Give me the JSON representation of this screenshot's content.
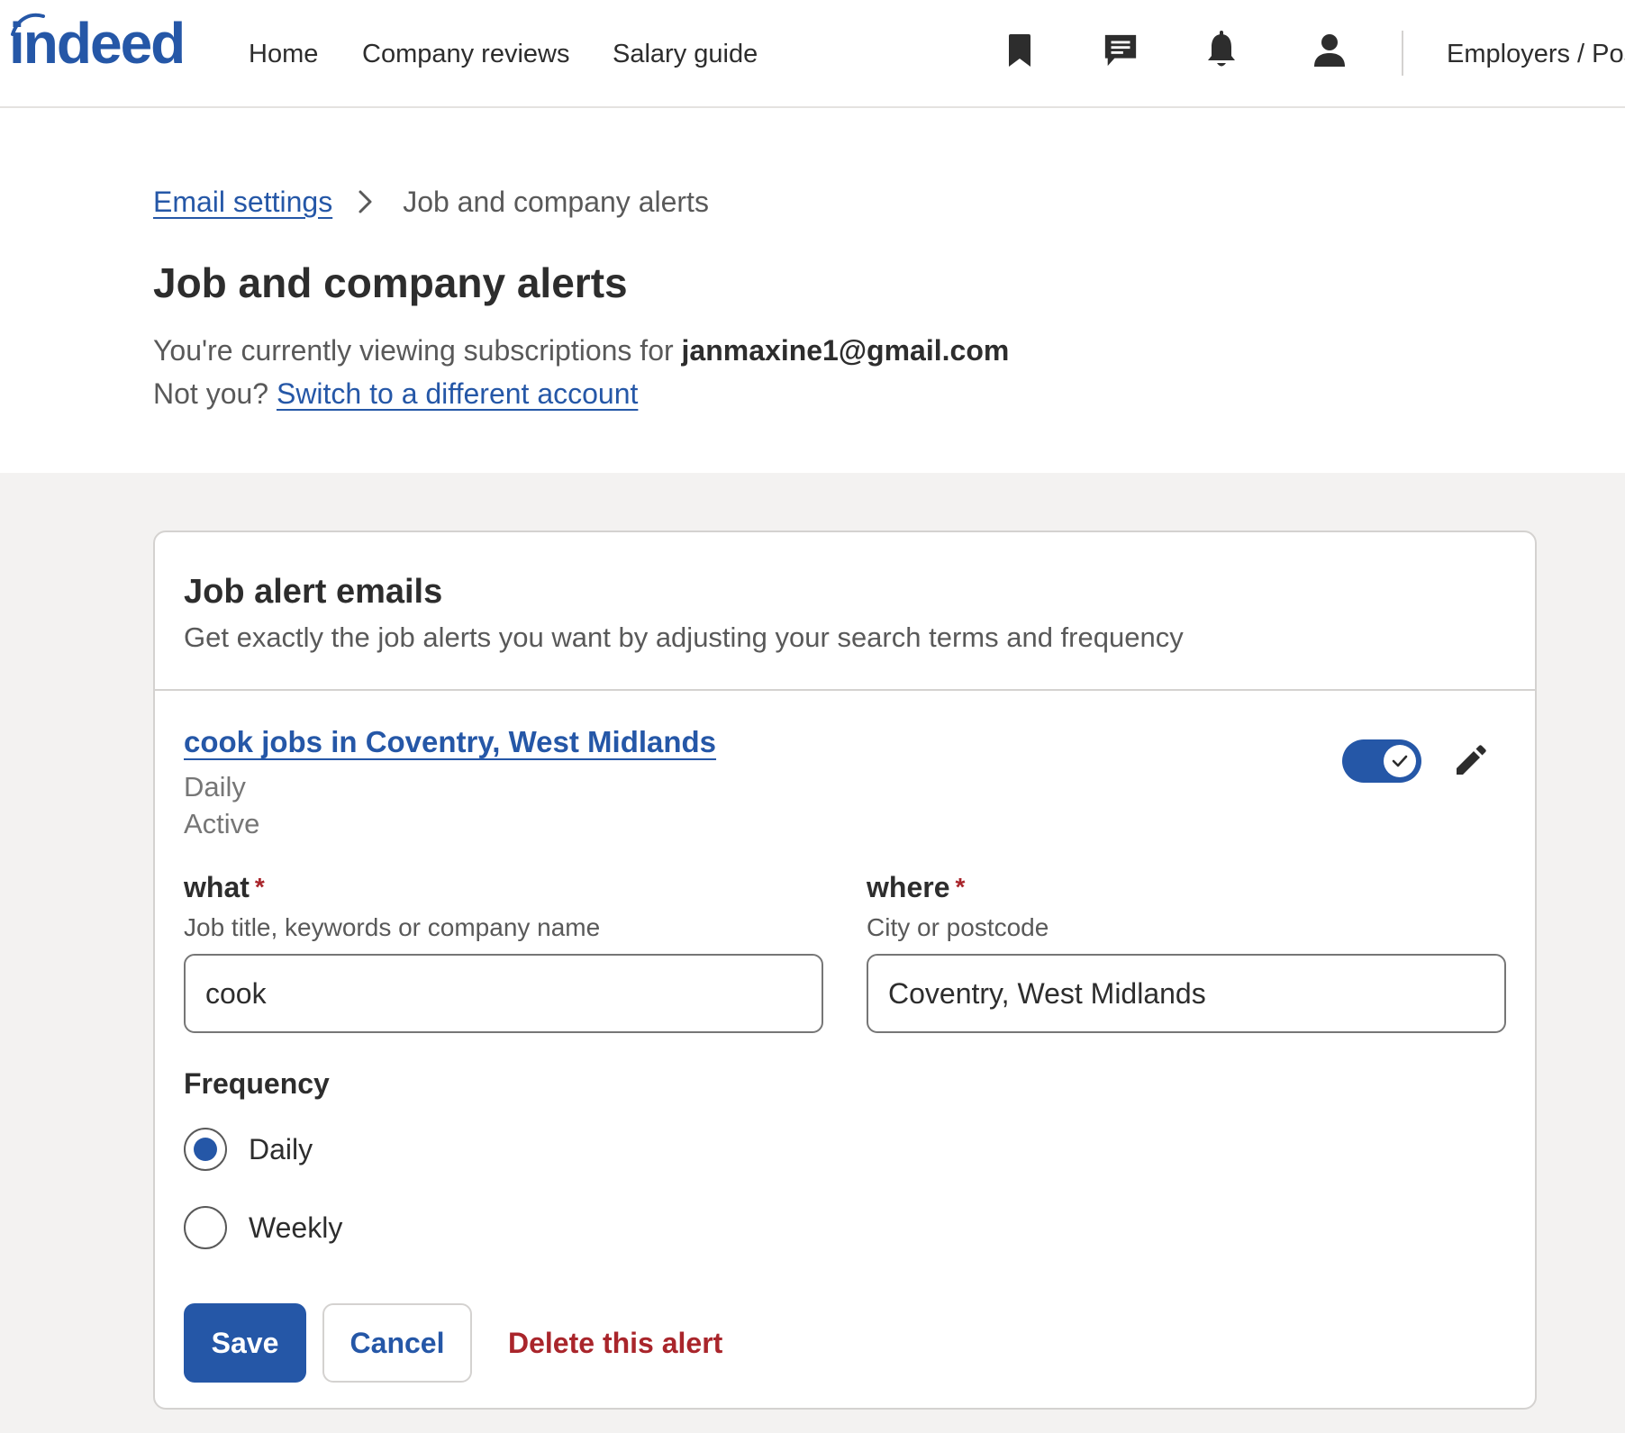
{
  "header": {
    "logo_text": "indeed",
    "nav": {
      "home": "Home",
      "company_reviews": "Company reviews",
      "salary_guide": "Salary guide"
    },
    "icons": {
      "saved": "bookmark-icon",
      "messages": "message-icon",
      "notifications": "bell-icon",
      "profile": "person-icon"
    },
    "employers_link": "Employers / Post Job"
  },
  "breadcrumb": {
    "parent": "Email settings",
    "current": "Job and company alerts"
  },
  "page": {
    "title": "Job and company alerts",
    "viewing_prefix": "You're currently viewing subscriptions for ",
    "email": "janmaxine1@gmail.com",
    "not_you": "Not you? ",
    "switch_link": "Switch to a different account"
  },
  "job_alerts": {
    "title": "Job alert emails",
    "subtitle": "Get exactly the job alerts you want by adjusting your search terms and frequency",
    "alert": {
      "link_text": "cook jobs in Coventry, West Midlands",
      "frequency": "Daily",
      "status": "Active",
      "enabled": true
    },
    "form": {
      "what_label": "what",
      "what_help": "Job title, keywords or company name",
      "what_value": "cook",
      "where_label": "where",
      "where_help": "City or postcode",
      "where_value": "Coventry, West Midlands",
      "required_mark": "*",
      "frequency_label": "Frequency",
      "options": [
        "Daily",
        "Weekly"
      ],
      "selected": "Daily",
      "save": "Save",
      "cancel": "Cancel",
      "delete": "Delete this alert"
    }
  },
  "colors": {
    "brand_blue": "#2557a7",
    "danger_red": "#a9252b",
    "page_grey": "#f3f2f1"
  }
}
